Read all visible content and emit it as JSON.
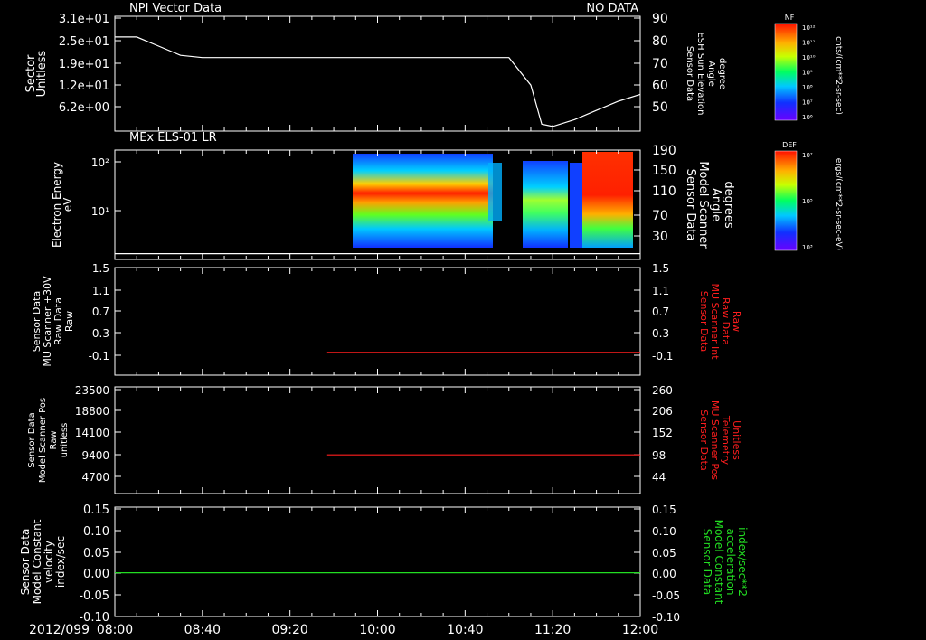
{
  "date_label": "2012/099",
  "time_ticks": [
    "08:00",
    "08:40",
    "09:20",
    "10:00",
    "10:40",
    "11:20",
    "12:00"
  ],
  "colors": {
    "white": "#ffffff",
    "red": "#ff1e1e",
    "green": "#22dd22"
  },
  "chart_data": [
    {
      "id": "p1",
      "type": "line",
      "title": "NPI Vector Data",
      "status": "NO DATA",
      "ylabel_left": [
        "Sector",
        "Unitless"
      ],
      "left_ticks": [
        "3.1e+01",
        "2.5e+01",
        "1.9e+01",
        "1.2e+01",
        "6.2e+00"
      ],
      "right_ticks": [
        "90",
        "80",
        "70",
        "60",
        "50"
      ],
      "ylabel_right": [
        "Sensor Data",
        "ESH Sun Elevation",
        "Angle",
        "degree"
      ],
      "ylim_right": [
        40,
        90
      ],
      "series": [
        {
          "name": "ESH Sun Elevation Angle",
          "x": [
            "08:00",
            "08:10",
            "08:20",
            "08:30",
            "08:40",
            "09:20",
            "10:00",
            "10:40",
            "11:00",
            "11:10",
            "11:15",
            "11:20",
            "11:30",
            "11:40",
            "11:50",
            "12:00"
          ],
          "y": [
            81,
            81,
            77,
            73,
            72,
            72,
            72,
            72,
            72,
            60,
            43,
            42,
            45,
            49,
            53,
            56
          ]
        }
      ]
    },
    {
      "id": "p2",
      "type": "heatmap",
      "title": "MEx ELS-01 LR",
      "ylabel_left": [
        "Electron Energy",
        "eV"
      ],
      "left_ticks": [
        "10²",
        "10¹"
      ],
      "right_ticks": [
        "190",
        "150",
        "110",
        "70",
        "30"
      ],
      "ylabel_right": [
        "Sensor Data",
        "Model Scanner",
        "Angle",
        "degrees"
      ],
      "ylim_right": [
        0,
        190
      ],
      "colorbar_label": "DEF",
      "colorbar_unit": "ergs/(cm**2-sr-sec-eV)",
      "colorbar_ticks": [
        "10⁷",
        "10⁵",
        "10³"
      ],
      "data_start": "09:42",
      "bands": [
        {
          "x": [
            "09:42",
            "10:37"
          ],
          "level": "red-yellow core near 30–40 eV"
        },
        {
          "x": [
            "10:53",
            "11:02"
          ],
          "level": "green-yellow, 10–50 eV"
        },
        {
          "x": [
            "11:25",
            "11:42"
          ],
          "level": "red-orange, 20–200 eV"
        }
      ],
      "series": [
        {
          "name": "Model Scanner Angle",
          "x": [
            "08:00",
            "12:00"
          ],
          "y": [
            10,
            10
          ]
        }
      ]
    },
    {
      "id": "p3",
      "type": "line",
      "ylabel_left": [
        "Sensor Data",
        "MU Scanner +30V",
        "Raw Data",
        "Raw"
      ],
      "left_ticks": [
        "1.5",
        "1.1",
        "0.7",
        "0.3",
        "-0.1"
      ],
      "right_ticks": [
        "1.5",
        "1.1",
        "0.7",
        "0.3",
        "-0.1"
      ],
      "ylabel_right": [
        "Sensor Data",
        "MU Scanner Int",
        "Raw Data",
        "Raw"
      ],
      "ylim": [
        -0.4,
        1.5
      ],
      "series": [
        {
          "name": "MU Scanner Int Raw Data",
          "x": [
            "09:37",
            "12:00"
          ],
          "y": [
            0.0,
            0.0
          ]
        }
      ]
    },
    {
      "id": "p4",
      "type": "line",
      "ylabel_left": [
        "Sensor Data",
        "Model Scanner Pos",
        "Raw",
        "unitless"
      ],
      "left_ticks": [
        "23500",
        "18800",
        "14100",
        "9400",
        "4700"
      ],
      "right_ticks": [
        "260",
        "206",
        "152",
        "98",
        "44"
      ],
      "ylabel_right": [
        "Sensor Data",
        "MU Scanner Pos",
        "Telemetry",
        "Unitless"
      ],
      "ylim_right": [
        -10,
        260
      ],
      "series": [
        {
          "name": "MU Scanner Pos Telemetry",
          "x": [
            "09:37",
            "12:00"
          ],
          "y": [
            88,
            88
          ]
        }
      ]
    },
    {
      "id": "p5",
      "type": "line",
      "ylabel_left": [
        "Sensor Data",
        "Model Constant",
        "velocity",
        "index/sec"
      ],
      "left_ticks": [
        "0.15",
        "0.10",
        "0.05",
        "0.00",
        "-0.05",
        "-0.10"
      ],
      "right_ticks": [
        "0.15",
        "0.10",
        "0.05",
        "0.00",
        "-0.05",
        "-0.10"
      ],
      "ylabel_right": [
        "Sensor Data",
        "Model Constant",
        "acceleration",
        "index/sec**2"
      ],
      "ylim": [
        -0.1,
        0.15
      ],
      "series": [
        {
          "name": "Model Constant acceleration",
          "x": [
            "08:00",
            "12:00"
          ],
          "y": [
            0.0,
            0.0
          ]
        }
      ]
    }
  ],
  "colorbars": [
    {
      "label": "NF",
      "unit": "cnts/(cm**2-sr-sec)",
      "ticks": [
        "10¹²",
        "10¹¹",
        "10¹⁰",
        "10⁹",
        "10⁸",
        "10⁷",
        "10⁶"
      ]
    },
    {
      "label": "DEF",
      "unit": "ergs/(cm**2-sr-sec-eV)",
      "ticks": [
        "10⁷",
        "10⁵",
        "10³"
      ]
    }
  ]
}
